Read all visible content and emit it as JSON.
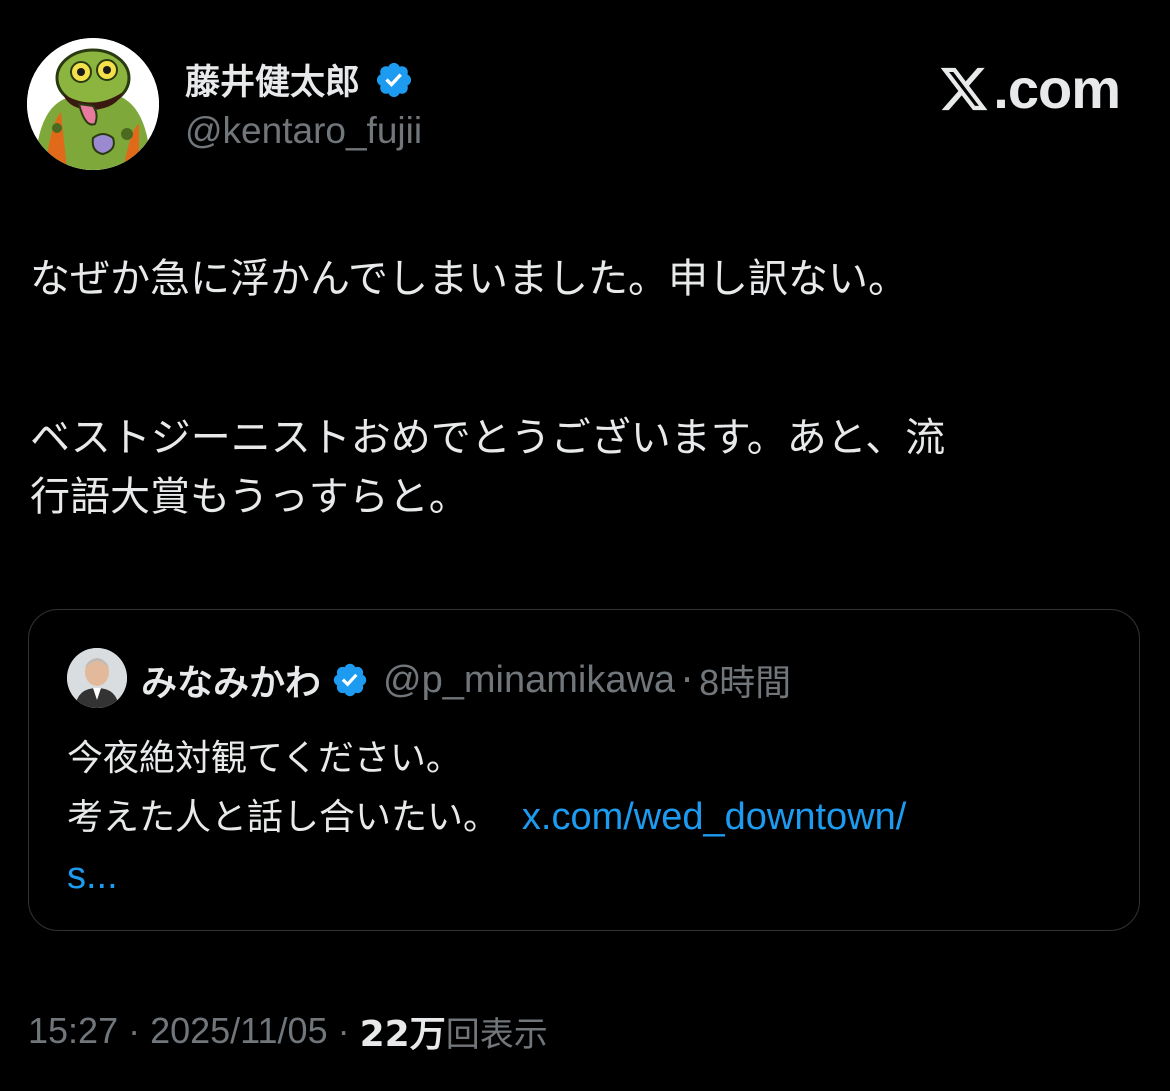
{
  "author": {
    "display_name": "藤井健太郎",
    "handle": "@kentaro_fujii",
    "verified_icon": "verified-badge-icon",
    "avatar_icon": "green-monster-avatar"
  },
  "brand": {
    "label": ".com",
    "logo_icon": "x-logo-icon"
  },
  "tweet": {
    "line1": "なぜか急に浮かんでしまいました。申し訳ない。",
    "line2": "ベストジーニストおめでとうございます。あと、流",
    "line3": "行語大賞もうっすらと。"
  },
  "quote": {
    "display_name": "みなみかわ",
    "handle": "@p_minamikawa",
    "separator": "·",
    "time": "8時間",
    "text_line1": "今夜絶対観てください。",
    "text_line2": "考えた人と話し合いたい。",
    "link_part1": "x.com/wed_downtown/",
    "link_part2": "s..."
  },
  "meta": {
    "time": "15:27",
    "separator": "·",
    "date": "2025/11/05",
    "views_count": "22万",
    "views_label": "回表示"
  },
  "colors": {
    "background": "#000000",
    "text": "#e7e9ea",
    "secondary": "#71767b",
    "link": "#1d9bf0",
    "verified": "#1d9bf0",
    "border": "#2f3336"
  }
}
